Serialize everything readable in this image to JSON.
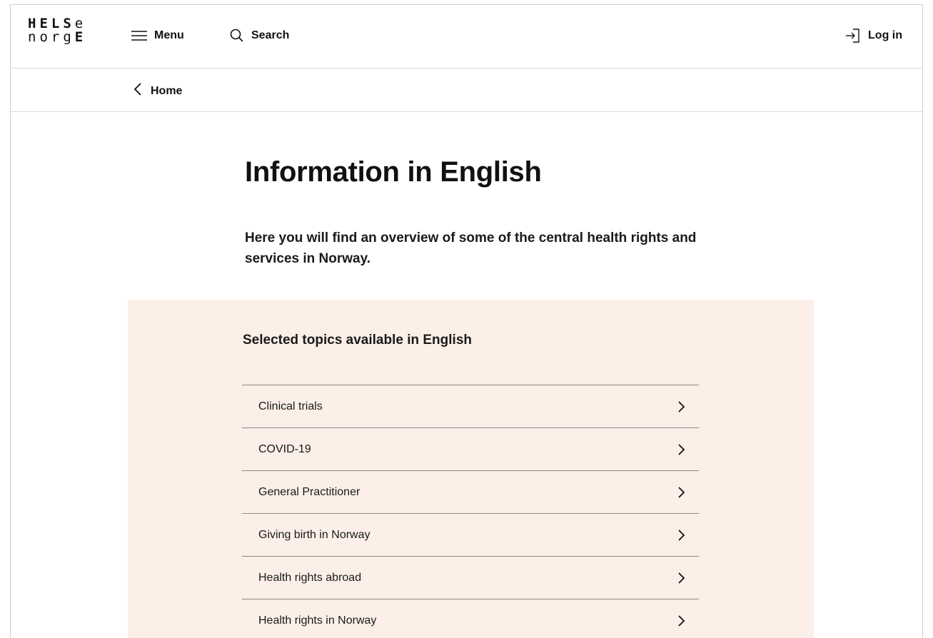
{
  "header": {
    "logo": {
      "line1_bold": "HELS",
      "line1_light": "e",
      "line2_light": "norg",
      "line2_bold": "E"
    },
    "menu_label": "Menu",
    "menu_icon": "hamburger-icon",
    "search_label": "Search",
    "search_icon": "search-icon",
    "login_label": "Log in",
    "login_icon": "login-icon"
  },
  "breadcrumb": {
    "label": "Home",
    "icon": "chevron-left-icon"
  },
  "page": {
    "title": "Information in English",
    "lead": "Here you will find an overview of some of the central health rights and services in Norway."
  },
  "topics": {
    "heading": "Selected topics available in English",
    "background": "#fbefe8",
    "items": [
      {
        "label": "Clinical trials"
      },
      {
        "label": "COVID-19"
      },
      {
        "label": "General Practitioner"
      },
      {
        "label": "Giving birth in Norway"
      },
      {
        "label": "Health rights abroad"
      },
      {
        "label": "Health rights in Norway"
      }
    ]
  }
}
